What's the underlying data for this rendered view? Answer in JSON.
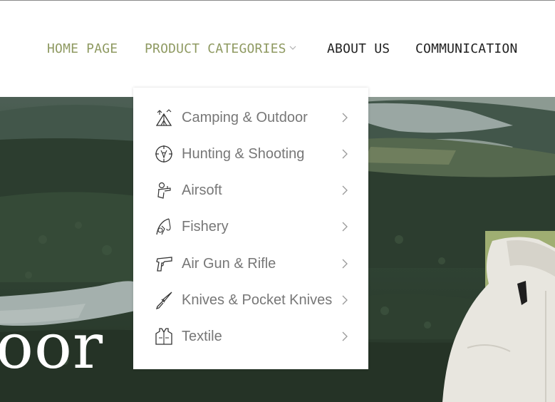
{
  "nav": {
    "items": [
      {
        "label": "HOME PAGE"
      },
      {
        "label": "PRODUCT CATEGORIES"
      },
      {
        "label": "ABOUT US"
      },
      {
        "label": "COMMUNICATION"
      }
    ]
  },
  "dropdown": {
    "items": [
      {
        "label": "Camping & Outdoor",
        "icon": "tent-icon"
      },
      {
        "label": "Hunting & Shooting",
        "icon": "crosshair-deer-icon"
      },
      {
        "label": "Airsoft",
        "icon": "airsoft-player-icon"
      },
      {
        "label": "Fishery",
        "icon": "fishing-rod-icon"
      },
      {
        "label": "Air Gun & Rifle",
        "icon": "pistol-icon"
      },
      {
        "label": "Knives & Pocket Knives",
        "icon": "knife-icon"
      },
      {
        "label": "Textile",
        "icon": "vest-icon"
      }
    ]
  },
  "hero": {
    "text": "oor"
  },
  "colors": {
    "accent": "#8f9a62",
    "panel_green": "#9fae72",
    "menu_text": "#777777",
    "nav_dark": "#222222"
  }
}
